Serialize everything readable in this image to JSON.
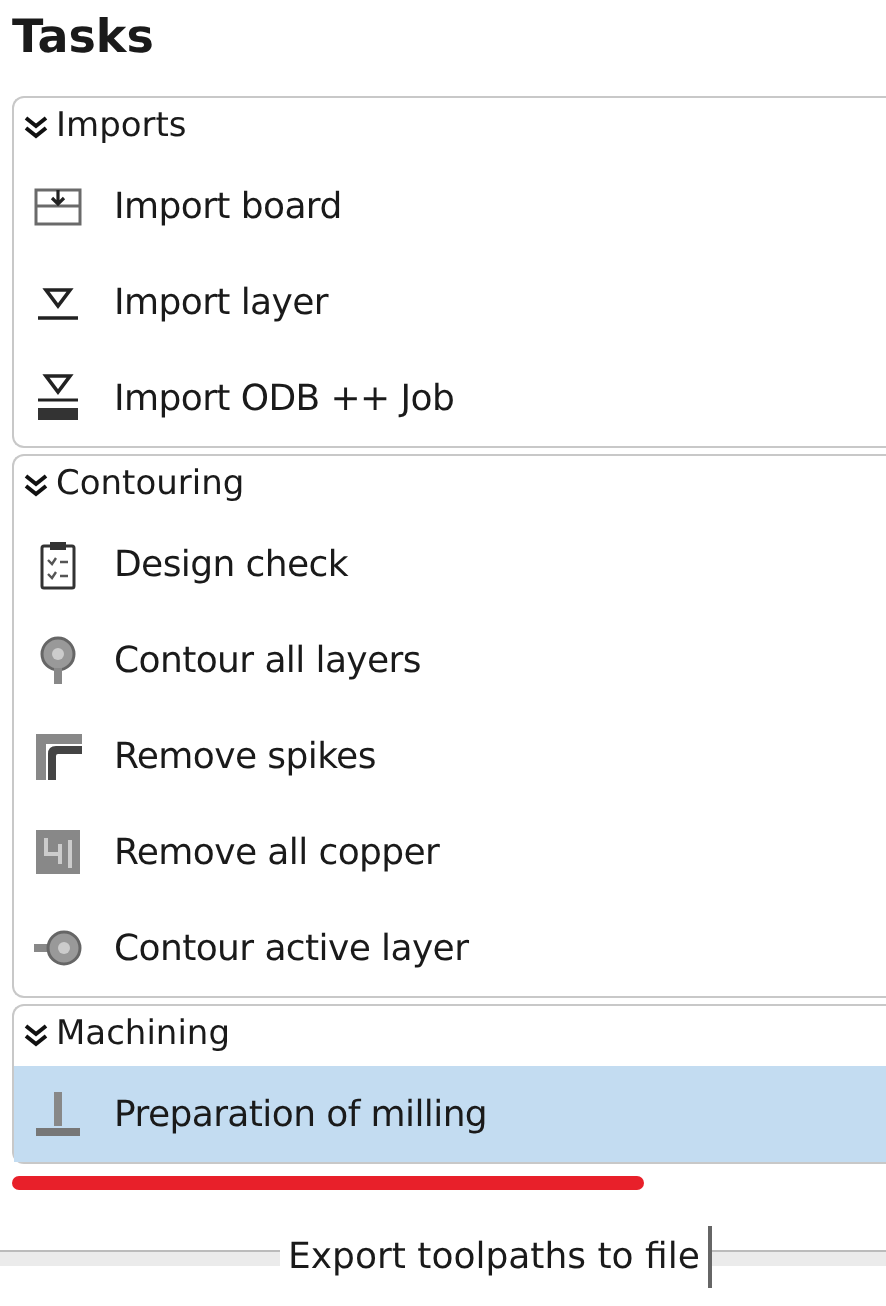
{
  "title": "Tasks",
  "groups": [
    {
      "label": "Imports",
      "expanded": true,
      "items": [
        {
          "label": "Import board",
          "kind": "board",
          "selected": false
        },
        {
          "label": "Import layer",
          "kind": "layer",
          "selected": false
        },
        {
          "label": "Import ODB ++ Job",
          "kind": "odb",
          "selected": false
        }
      ]
    },
    {
      "label": "Contouring",
      "expanded": true,
      "items": [
        {
          "label": "Design check",
          "kind": "clipboard",
          "selected": false
        },
        {
          "label": "Contour all layers",
          "kind": "pad",
          "selected": false
        },
        {
          "label": "Remove spikes",
          "kind": "corner",
          "selected": false
        },
        {
          "label": "Remove all copper",
          "kind": "circuit",
          "selected": false
        },
        {
          "label": "Contour active layer",
          "kind": "padside",
          "selected": false
        }
      ]
    },
    {
      "label": "Machining",
      "expanded": true,
      "items": [
        {
          "label": "Preparation of milling",
          "kind": "mill",
          "selected": true
        }
      ]
    }
  ],
  "tooltip": {
    "text": "Export toolpaths to file"
  }
}
